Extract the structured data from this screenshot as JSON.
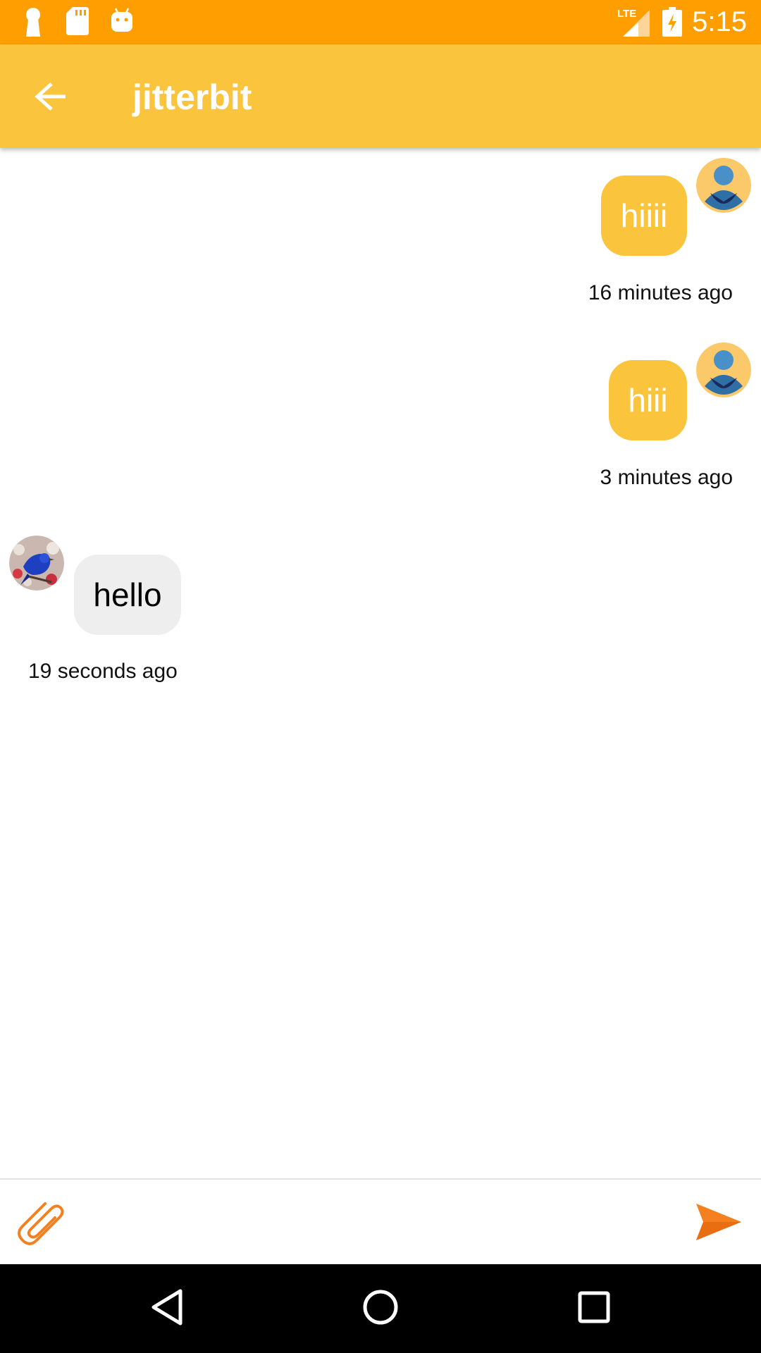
{
  "status_bar": {
    "time": "5:15",
    "network": "LTE",
    "left_icons": [
      "keyhole-icon",
      "sd-card-icon",
      "android-icon"
    ],
    "right_icons": [
      "signal-icon",
      "battery-charging-icon"
    ]
  },
  "header": {
    "title": "jitterbit",
    "back_icon": "arrow-left-icon"
  },
  "messages": [
    {
      "direction": "outgoing",
      "text": "hiiii",
      "time": "16 minutes ago",
      "avatar": "default-user-avatar"
    },
    {
      "direction": "outgoing",
      "text": "hiii",
      "time": "3 minutes ago",
      "avatar": "default-user-avatar"
    },
    {
      "direction": "incoming",
      "text": "hello",
      "time": "19 seconds ago",
      "avatar": "blue-bird-avatar"
    }
  ],
  "composer": {
    "value": "",
    "placeholder": "",
    "attach_icon": "paperclip-icon",
    "send_icon": "send-icon"
  },
  "nav_bar": {
    "icons": [
      "back-triangle-icon",
      "home-circle-icon",
      "recents-square-icon"
    ]
  },
  "colors": {
    "status_bar": "#FF9E00",
    "app_bar": "#FBC43D",
    "outgoing_bubble": "#FBC43D",
    "incoming_bubble": "#EEEEEE",
    "accent_orange": "#F58020"
  }
}
